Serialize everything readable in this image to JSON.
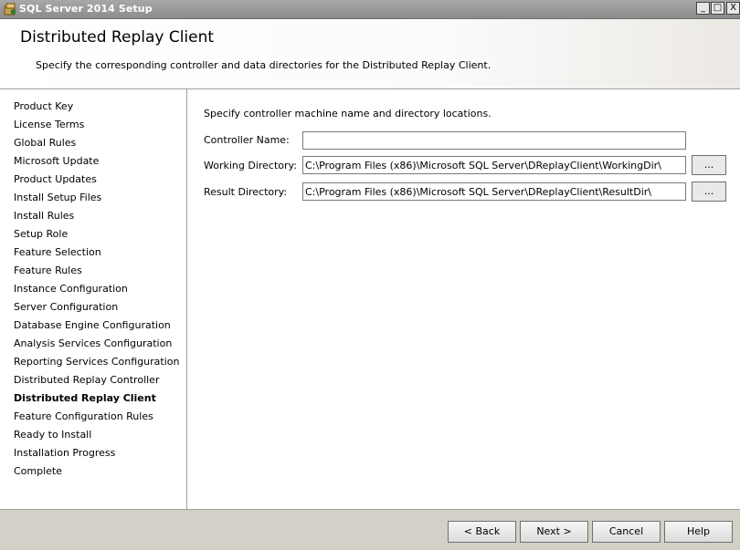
{
  "window": {
    "title": "SQL Server 2014 Setup"
  },
  "window_controls": {
    "minimize": "_",
    "maximize": "□",
    "close": "X"
  },
  "header": {
    "title": "Distributed Replay Client",
    "description": "Specify the corresponding controller and data directories for the Distributed Replay Client."
  },
  "sidebar": {
    "items": [
      {
        "label": "Product Key"
      },
      {
        "label": "License Terms"
      },
      {
        "label": "Global Rules"
      },
      {
        "label": "Microsoft Update"
      },
      {
        "label": "Product Updates"
      },
      {
        "label": "Install Setup Files"
      },
      {
        "label": "Install Rules"
      },
      {
        "label": "Setup Role"
      },
      {
        "label": "Feature Selection"
      },
      {
        "label": "Feature Rules"
      },
      {
        "label": "Instance Configuration"
      },
      {
        "label": "Server Configuration"
      },
      {
        "label": "Database Engine Configuration"
      },
      {
        "label": "Analysis Services Configuration"
      },
      {
        "label": "Reporting Services Configuration"
      },
      {
        "label": "Distributed Replay Controller"
      },
      {
        "label": "Distributed Replay Client"
      },
      {
        "label": "Feature Configuration Rules"
      },
      {
        "label": "Ready to Install"
      },
      {
        "label": "Installation Progress"
      },
      {
        "label": "Complete"
      }
    ],
    "active_index": 16
  },
  "main": {
    "intro": "Specify controller machine name and directory locations.",
    "controller": {
      "label": "Controller Name:",
      "value": ""
    },
    "working": {
      "label": "Working Directory:",
      "value": "C:\\Program Files (x86)\\Microsoft SQL Server\\DReplayClient\\WorkingDir\\",
      "browse_label": "..."
    },
    "result": {
      "label": "Result Directory:",
      "value": "C:\\Program Files (x86)\\Microsoft SQL Server\\DReplayClient\\ResultDir\\",
      "browse_label": "..."
    }
  },
  "footer": {
    "back": "< Back",
    "next": "Next >",
    "cancel": "Cancel",
    "help": "Help"
  }
}
